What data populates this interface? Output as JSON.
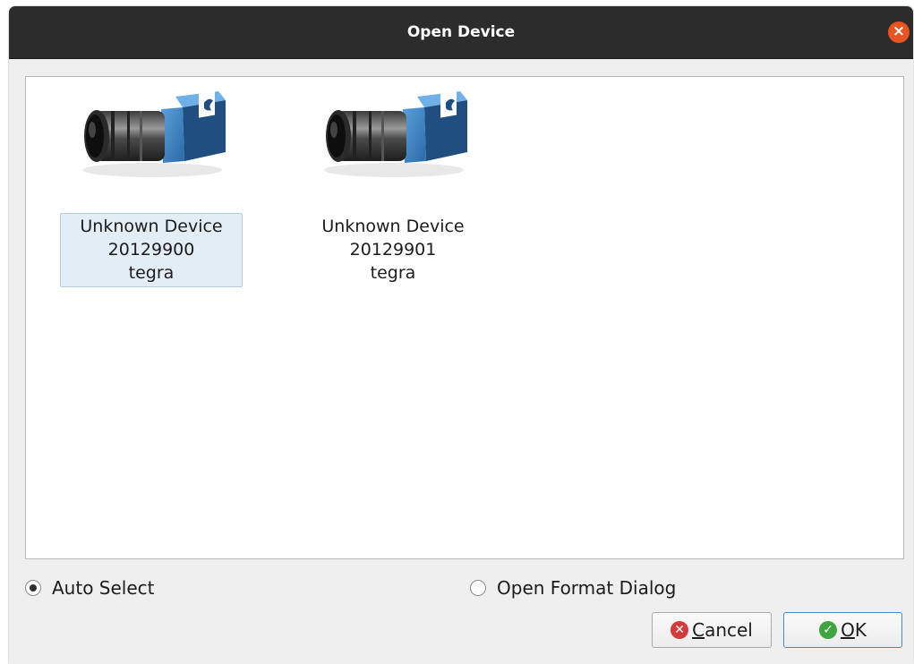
{
  "window": {
    "title": "Open Device",
    "close_symbol": "×"
  },
  "devices": [
    {
      "line1": "Unknown Device",
      "line2": "20129900",
      "line3": "tegra",
      "selected": true,
      "icon": "camera-icon"
    },
    {
      "line1": "Unknown Device",
      "line2": "20129901",
      "line3": "tegra",
      "selected": false,
      "icon": "camera-icon"
    }
  ],
  "options": {
    "auto_select": {
      "label": "Auto Select",
      "checked": true
    },
    "open_format_dialog": {
      "label": "Open Format Dialog",
      "checked": false
    }
  },
  "buttons": {
    "cancel": {
      "mnemonic": "C",
      "rest": "ancel",
      "icon": "x-circle-icon",
      "icon_glyph": "✕",
      "color": "#d53a3a"
    },
    "ok": {
      "mnemonic": "O",
      "rest": "K",
      "icon": "check-circle-icon",
      "icon_glyph": "✓",
      "color": "#3fa63f"
    }
  },
  "colors": {
    "titlebar": "#2c2c2c",
    "close_button": "#e95420",
    "selection": "#e3edf6",
    "camera_housing": "#3f86c8"
  }
}
